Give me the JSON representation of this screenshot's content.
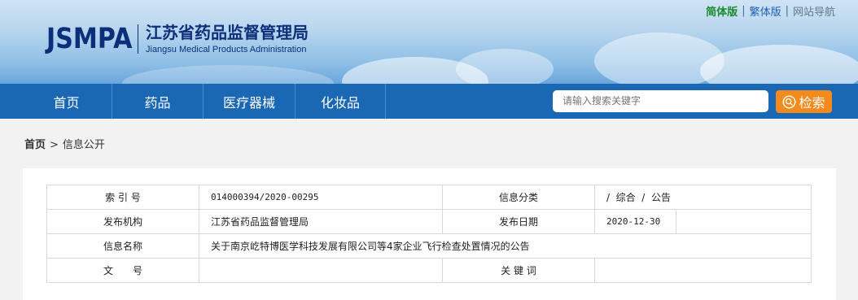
{
  "header": {
    "logo_abbr": "JSMPA",
    "org_name_cn": "江苏省药品监督管理局",
    "org_name_en": "Jiangsu Medical Products Administration",
    "top_links": [
      "简体版",
      "繁体版",
      "网站导航"
    ],
    "separator": "|"
  },
  "nav": {
    "items": [
      "首页",
      "药品",
      "医疗器械",
      "化妆品"
    ],
    "search_placeholder": "请输入搜索关键字",
    "search_button": "检索"
  },
  "breadcrumb": {
    "home": "首页",
    "arrow": ">",
    "current": "信息公开"
  },
  "info_table": {
    "row1": {
      "label1": "索 引 号",
      "value1": "014000394/2020-00295",
      "label2": "信息分类",
      "value2": "/  综合  /  公告"
    },
    "row2": {
      "label1": "发布机构",
      "value1": "江苏省药品监督管理局",
      "label2": "发布日期",
      "value2": "2020-12-30"
    },
    "row3": {
      "label1": "信息名称",
      "value1": "关于南京屹特博医学科技发展有限公司等4家企业飞行检查处置情况的公告"
    },
    "row4": {
      "label1": "文　　号",
      "value1": "",
      "label2": "关 键 词",
      "value2": ""
    }
  },
  "colors": {
    "nav_bg": "#1a67b4",
    "search_button": "#f28a1d",
    "logo": "#0d2e78",
    "simplified_link": "#1a8a2e",
    "traditional_link": "#1d5fb5"
  }
}
